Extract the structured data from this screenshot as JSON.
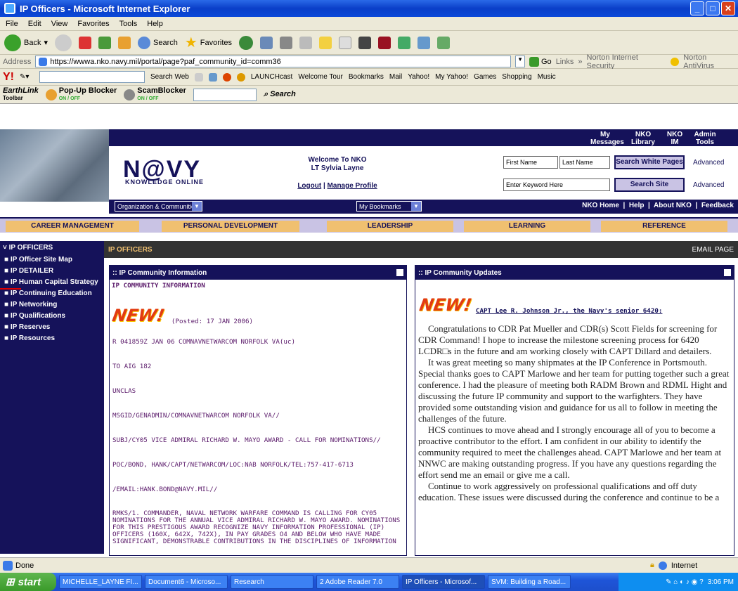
{
  "window": {
    "title": "IP Officers - Microsoft Internet Explorer"
  },
  "menu": [
    "File",
    "Edit",
    "View",
    "Favorites",
    "Tools",
    "Help"
  ],
  "toolbar": {
    "back": "Back",
    "search": "Search",
    "favorites": "Favorites"
  },
  "address": {
    "label": "Address",
    "url": "https://wwwa.nko.navy.mil/portal/page?paf_community_id=comm36",
    "go": "Go",
    "links": "Links",
    "norton_security": "Norton Internet Security",
    "norton_antivirus": "Norton AntiVirus"
  },
  "yahoo": {
    "search_web": "Search Web",
    "items": [
      "LAUNCHcast",
      "Welcome Tour",
      "Bookmarks",
      "Mail",
      "Yahoo!",
      "My Yahoo!",
      "Games",
      "Shopping",
      "Music"
    ]
  },
  "earthlink": {
    "name": "EarthLink",
    "sub": "Toolbar",
    "popup": "Pop-Up Blocker",
    "scam": "ScamBlocker",
    "onoff": "ON / OFF",
    "search": "Search"
  },
  "page": {
    "logo": "N@VY",
    "logo_sub": "KNOWLEDGE ONLINE",
    "welcome": "Welcome To NKO",
    "user": "LT Sylvia Layne",
    "logout": "Logout",
    "manage_profile": "Manage Profile",
    "first_name": "First Name",
    "last_name": "Last Name",
    "search_white_pages": "Search White Pages",
    "advanced": "Advanced",
    "keyword_placeholder": "Enter Keyword Here",
    "search_site": "Search Site",
    "topnav": [
      "My Messages",
      "NKO Library",
      "NKO IM",
      "Admin Tools"
    ],
    "org_select": "Organization & Communities",
    "bookmarks_select": "My Bookmarks",
    "links": [
      "NKO Home",
      "Help",
      "About NKO",
      "Feedback"
    ],
    "mainnav": [
      "CAREER MANAGEMENT",
      "PERSONAL DEVELOPMENT",
      "LEADERSHIP",
      "LEARNING",
      "REFERENCE"
    ],
    "left_header": "IP OFFICERS",
    "left_items": [
      "IP Officer Site Map",
      "IP DETAILER",
      "IP Human Capital Strategy",
      "IP Continuing Education",
      "IP Networking",
      "IP Qualifications",
      "IP Reserves",
      "IP Resources"
    ],
    "section_title": "IP OFFICERS",
    "email_page": "EMAIL PAGE",
    "panel1": {
      "header": ":: IP Community Information",
      "title": "IP COMMUNITY INFORMATION",
      "new": "NEW!",
      "posted": "(Posted: 17 JAN 2006)",
      "lines": [
        "R 041859Z JAN 06 COMNAVNETWARCOM NORFOLK VA(uc)",
        "TO AIG 182",
        "UNCLAS",
        "MSGID/GENADMIN/COMNAVNETWARCOM NORFOLK VA//",
        "SUBJ/CY05 VICE ADMIRAL RICHARD W. MAYO AWARD - CALL FOR NOMINATIONS//",
        "POC/BOND, HANK/CAPT/NETWARCOM/LOC:NAB NORFOLK/TEL:757-417-6713",
        "/EMAIL:HANK.BOND@NAVY.MIL//"
      ],
      "rmks": "RMKS/1. COMMANDER, NAVAL NETWORK WARFARE COMMAND IS CALLING FOR CY05 NOMINATIONS FOR THE ANNUAL VICE ADMIRAL RICHARD W. MAYO AWARD. NOMINATIONS FOR THIS PRESTIGOUS AWARD RECOGNIZE NAVY INFORMATION PROFESSIONAL (IP) OFFICERS (160X, 642X, 742X), IN PAY GRADES O4 AND BELOW WHO HAVE MADE SIGNIFICANT, DEMONSTRABLE CONTRIBUTIONS IN THE DISCIPLINES OF INFORMATION"
    },
    "panel2": {
      "header": ":: IP Community Updates",
      "new": "NEW!",
      "byline": "CAPT Lee R. Johnson Jr., the Navy's senior 6420:",
      "paragraphs": [
        "Congratulations to CDR Pat Mueller and CDR(s) Scott Fields for screening for CDR Command!  I hope to increase the milestone screening process for 6420 LCDR□s in the future and am working closely with CAPT Dillard and detailers.",
        "It was great meeting so many shipmates at the IP Conference in Portsmouth. Special thanks goes to CAPT Marlowe and her team for putting together such a great conference.  I had the pleasure of meeting both RADM Brown and RDML Hight and discussing the future IP community and support to the warfighters.  They have provided some outstanding vision and guidance for us all to follow in meeting the challenges of the future.",
        "HCS continues to move ahead and I strongly encourage all of you to become a proactive contributor to the effort.  I am confident in our ability to identify the community required to meet the challenges ahead.  CAPT Marlowe and her team at NNWC are making outstanding progress.  If you have any questions regarding the effort send me an email or give me a call.",
        "Continue to work aggressively on professional qualifications and off duty education.  These issues were discussed during the conference and continue to be a"
      ]
    }
  },
  "status": {
    "text": "Done",
    "zone": "Internet"
  },
  "taskbar": {
    "start": "start",
    "tasks": [
      "MICHELLE_LAYNE FI...",
      "Document6 - Microso...",
      "Research",
      "2 Adobe Reader 7.0",
      "IP Officers - Microsof...",
      "SVM: Building a Road..."
    ],
    "clock": "3:06 PM"
  }
}
